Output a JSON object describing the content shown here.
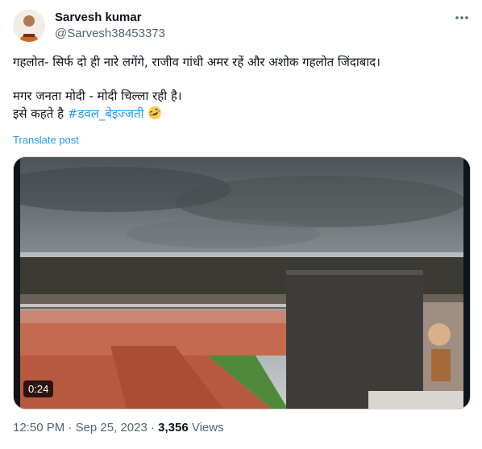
{
  "author": {
    "name": "Sarvesh kumar",
    "handle": "@Sarvesh38453373"
  },
  "tweet": {
    "line1": "गहलोत- सिर्फ दो ही नारे लगेंगे, राजीव गांधी अमर रहें और अशोक गहलोत जिंदाबाद।",
    "line2": "मगर जनता मोदी - मोदी चिल्ला रही है।",
    "line3_prefix": "इसे कहते है ",
    "hashtag": "#डवल_बेइज्जती",
    "emoji": "rolling-on-floor-laughing"
  },
  "translate_label": "Translate post",
  "media": {
    "duration": "0:24"
  },
  "meta": {
    "time": "12:50 PM",
    "separator": " · ",
    "date": "Sep 25, 2023",
    "views_count": "3,356",
    "views_label": " Views"
  },
  "colors": {
    "link": "#1d9bf0",
    "secondary_text": "#536471",
    "primary_text": "#0f1419"
  }
}
